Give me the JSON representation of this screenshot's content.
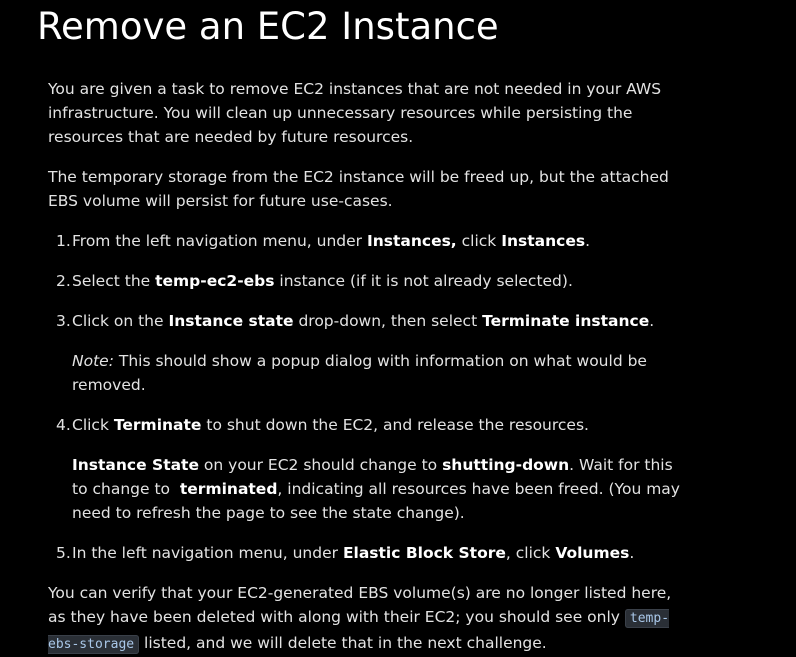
{
  "title": "Remove an EC2 Instance",
  "intro": [
    "You are given a task to remove EC2 instances that are not needed in your AWS infrastructure. You will clean up unnecessary resources while persisting the resources that are needed by future resources.",
    "The temporary storage from the EC2 instance will be freed up, but the attached EBS volume will persist for future use-cases."
  ],
  "steps": [
    {
      "num": "1.",
      "t1": "From the left navigation menu, under ",
      "b1": "Instances,",
      "t2": " click ",
      "b2": "Instances",
      "t3": "."
    },
    {
      "num": "2.",
      "t1": "Select the ",
      "b1": "temp-ec2-ebs",
      "t2": " instance (if it is not already selected)."
    },
    {
      "num": "3.",
      "t1": "Click on the ",
      "b1": "Instance state",
      "t2": " drop-down, then select ",
      "b2": "Terminate instance",
      "t3": ".",
      "note_label": "Note:",
      "note_text": " This should show a popup dialog with information on what would be removed."
    },
    {
      "num": "4.",
      "t1": "Click ",
      "b1": "Terminate",
      "t2": " to shut down the EC2, and release the resources.",
      "p2_b1": "Instance State",
      "p2_t1": " on your EC2 should change to ",
      "p2_b2": "shutting-down",
      "p2_t2": ". Wait for this to change to  ",
      "p2_b3": "terminated",
      "p2_t3": ", indicating all resources have been freed. (You may need to refresh the page to see the state change)."
    },
    {
      "num": "5.",
      "t1": "In the left navigation menu, under ",
      "b1": "Elastic Block Store",
      "t2": ", click ",
      "b2": "Volumes",
      "t3": "."
    }
  ],
  "outro": {
    "t1": "You can verify that your EC2-generated EBS volume(s) are no longer listed here, as they have been deleted with along with their EC2; you should see only ",
    "code": "temp-ebs-storage",
    "t2": " listed, and we will delete that in the next challenge."
  }
}
